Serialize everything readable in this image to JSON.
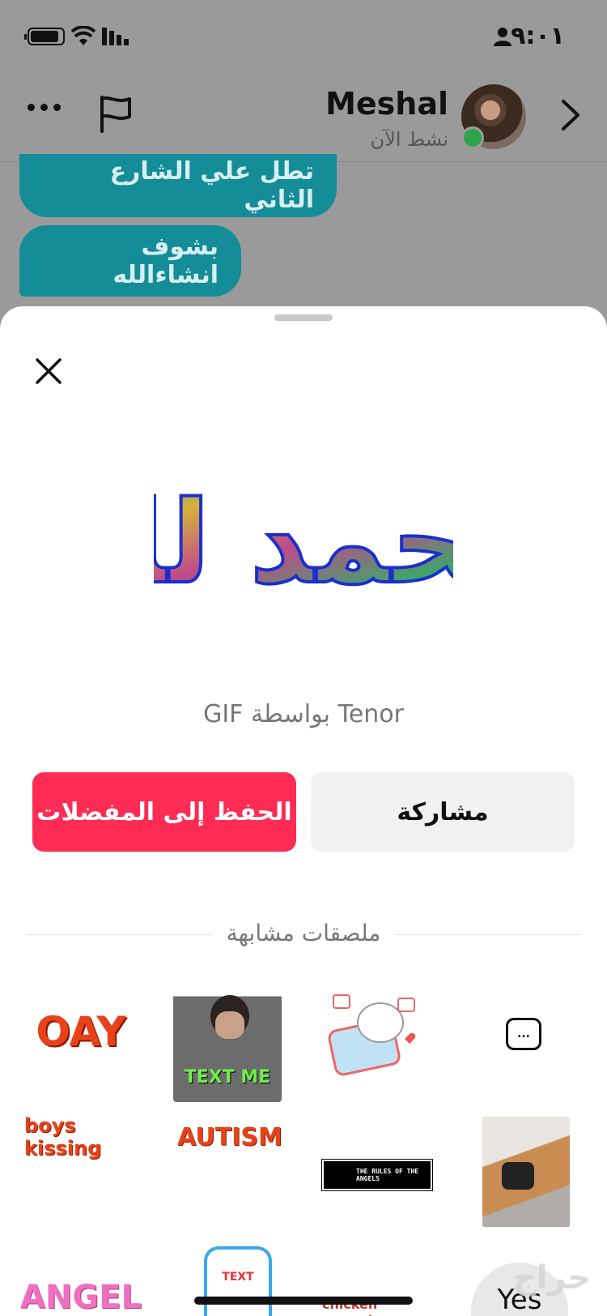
{
  "status_bar": {
    "time": "٩:٠١"
  },
  "header": {
    "contact_name": "Meshal",
    "contact_status": "نشط الآن"
  },
  "messages": [
    {
      "text": "تطل علي الشارع الثاني"
    },
    {
      "text": "بشوف انشاءالله"
    }
  ],
  "sheet": {
    "gif_title": "الحمد لله",
    "credit": "Tenor بواسطة GIF",
    "save_button": "الحفظ إلى المفضلات",
    "share_button": "مشاركة",
    "similar_title": "ملصقات مشابهة"
  },
  "stickers": {
    "r1": [
      "OAY",
      "TEXT ME",
      "",
      "..."
    ],
    "r2": [
      "boys kissing",
      "AUTISM",
      "THE RULES OF THE ANGELS"
    ],
    "r3": [
      "ANGEL",
      "TEXT",
      "chicken nuggets",
      "Yes"
    ]
  },
  "watermark": "حراج",
  "colors": {
    "accent": "#fe2c55",
    "bubble": "#148d98",
    "online": "#2ea44f"
  },
  "icons": [
    "battery-icon",
    "wifi-icon",
    "signal-icon",
    "person-icon",
    "more-icon",
    "flag-icon",
    "back-chevron-icon",
    "close-icon"
  ]
}
